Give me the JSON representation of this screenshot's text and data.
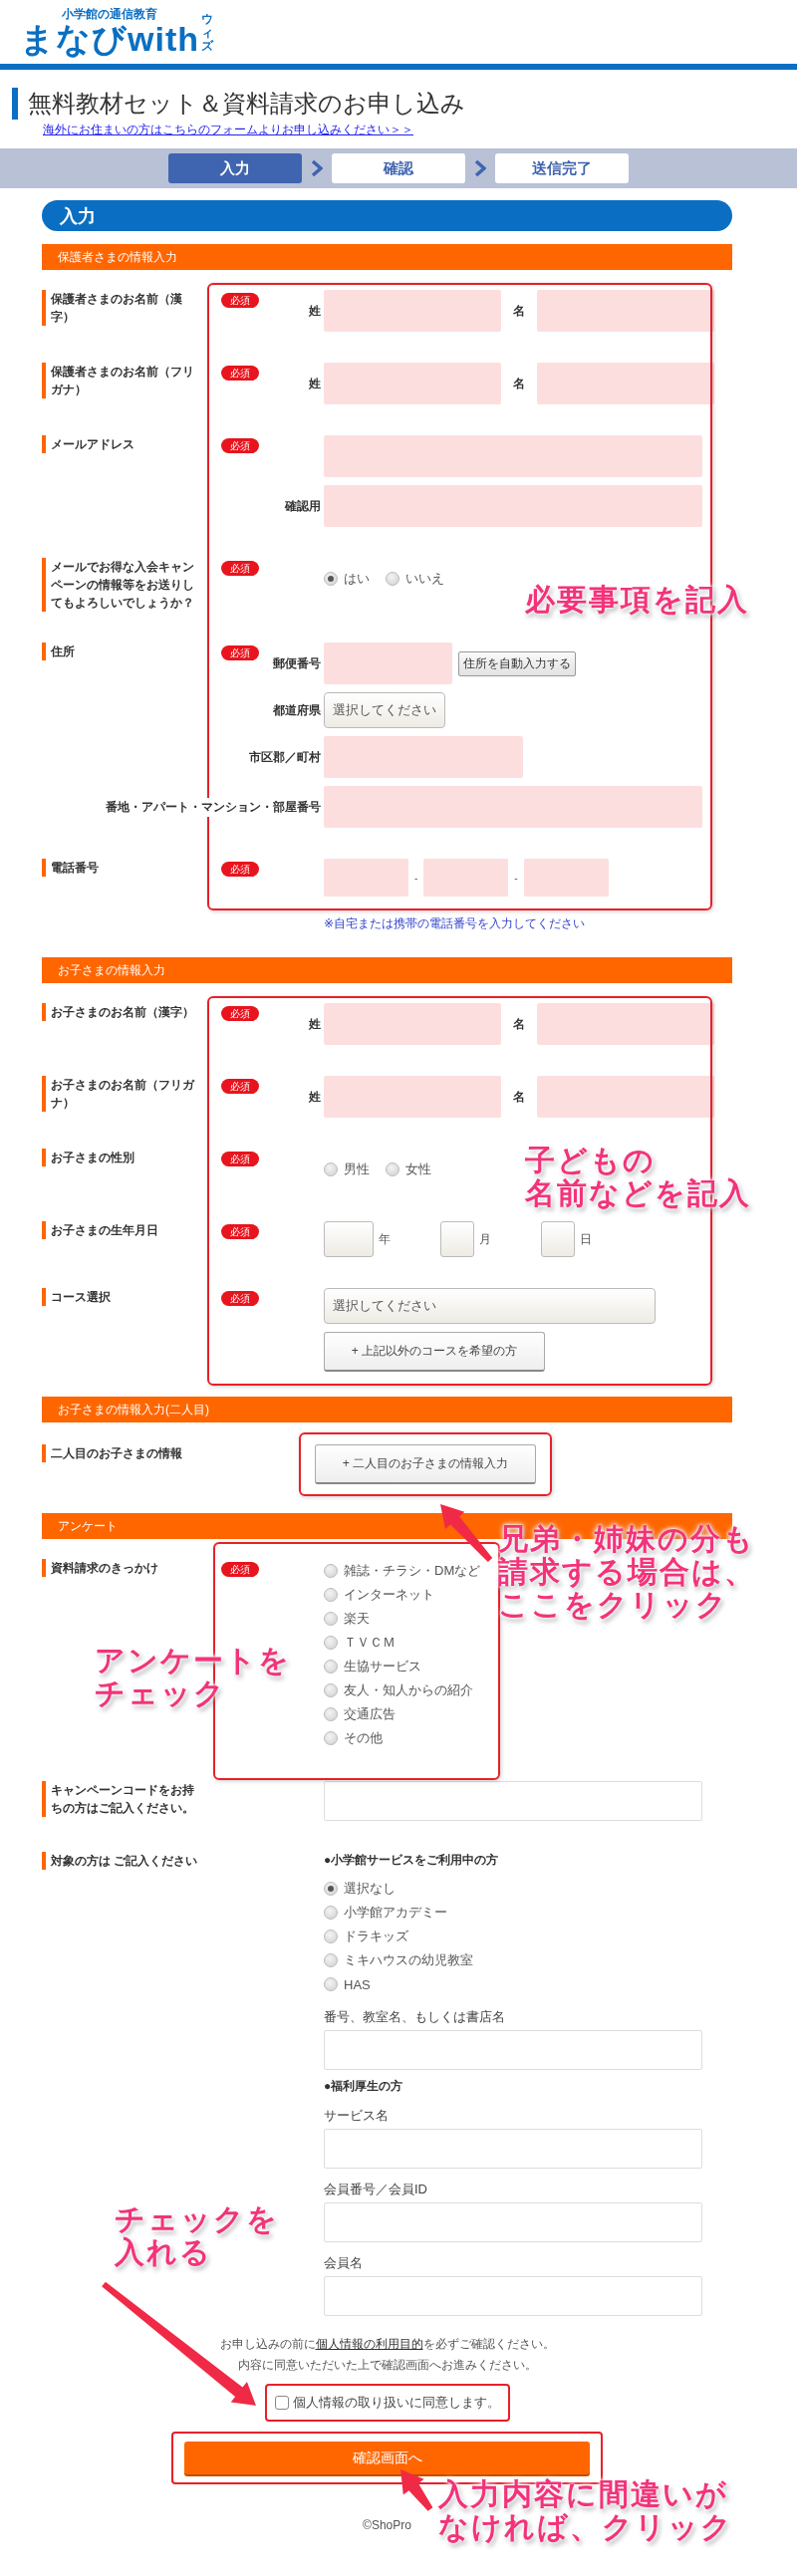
{
  "header": {
    "tagline": "小学館の通信教育",
    "wordmark": "まなびwith",
    "reading": "ウィズ"
  },
  "page_title": "無料教材セット＆資料請求のお申し込み",
  "overseas_link": "海外にお住まいの方はこちらのフォームよりお申し込みください＞＞",
  "steps": [
    {
      "label": "入力",
      "selected": true
    },
    {
      "label": "確認",
      "selected": false
    },
    {
      "label": "送信完了",
      "selected": false
    }
  ],
  "form_heading": "入力",
  "sections": [
    {
      "title": "保護者さまの情報入力",
      "kind": "rows",
      "note": "※自宅または携帯の電話番号を入力してください",
      "rows": [
        {
          "label": "保護者さまのお名前（漢字）",
          "badge": "必須",
          "lines": [
            {
              "kind": "pair",
              "parts": [
                "姓",
                "名"
              ]
            }
          ]
        },
        {
          "label": "保護者さまのお名前（フリガナ）",
          "badge": "必須",
          "lines": [
            {
              "kind": "pair",
              "parts": [
                "姓",
                "名"
              ]
            }
          ]
        },
        {
          "label": "メールアドレス",
          "badge": "必須",
          "lines": [
            {
              "kind": "wide"
            },
            {
              "kind": "wide",
              "label": "確認用"
            }
          ]
        },
        {
          "label": "メールでお得な入会キャンペーンの情報等をお送りしてもよろしいでしょうか？",
          "badge": "必須",
          "lines": [
            {
              "kind": "radio_row",
              "options": [
                {
                  "label": "はい",
                  "selected": true
                },
                {
                  "label": "いいえ",
                  "selected": false
                }
              ]
            }
          ]
        },
        {
          "label": "住所",
          "badge": "必須",
          "lines": [
            {
              "kind": "zip",
              "label": "郵便番号",
              "button": "住所を自動入力する"
            },
            {
              "kind": "select",
              "label": "都道府県",
              "value": "選択してください"
            },
            {
              "kind": "mid",
              "label": "市区郡／町村"
            },
            {
              "kind": "wide",
              "label": "番地・アパート・マンション・部屋番号"
            }
          ]
        },
        {
          "label": "電話番号",
          "badge": "必須",
          "lines": [
            {
              "kind": "phone",
              "separators": [
                "-",
                "-"
              ]
            }
          ]
        }
      ]
    },
    {
      "title": "お子さまの情報入力",
      "kind": "rows",
      "rows": [
        {
          "label": "お子さまのお名前（漢字）",
          "badge": "必須",
          "lines": [
            {
              "kind": "pair",
              "parts": [
                "姓",
                "名"
              ]
            }
          ]
        },
        {
          "label": "お子さまのお名前（フリガナ）",
          "badge": "必須",
          "lines": [
            {
              "kind": "pair",
              "parts": [
                "姓",
                "名"
              ]
            }
          ]
        },
        {
          "label": "お子さまの性別",
          "badge": "必須",
          "lines": [
            {
              "kind": "radio_row",
              "options": [
                {
                  "label": "男性",
                  "selected": false
                },
                {
                  "label": "女性",
                  "selected": false
                }
              ]
            }
          ]
        },
        {
          "label": "お子さまの生年月日",
          "badge": "必須",
          "lines": [
            {
              "kind": "date",
              "units": [
                "年",
                "月",
                "日"
              ]
            }
          ]
        },
        {
          "label": "コース選択",
          "badge": "必須",
          "lines": [
            {
              "kind": "long_select",
              "value": "選択してください"
            },
            {
              "kind": "add_button",
              "text": "+ 上記以外のコースを希望の方"
            }
          ]
        }
      ]
    },
    {
      "title": "お子さまの情報入力(二人目)",
      "kind": "control",
      "rows": [
        {
          "label": "二人目のお子さまの情報",
          "lines": [
            {
              "kind": "add_button",
              "text": "+ 二人目のお子さまの情報入力"
            }
          ]
        }
      ]
    },
    {
      "title": "アンケート",
      "kind": "options",
      "rows": [
        {
          "label": "資料請求のきっかけ",
          "badge": "必須",
          "lines": [
            {
              "kind": "radio_list",
              "options": [
                {
                  "label": "雑誌・チラシ・DMなど",
                  "selected": false
                },
                {
                  "label": "インターネット",
                  "selected": false
                },
                {
                  "label": "楽天",
                  "selected": false
                },
                {
                  "label": "ＴＶＣＭ",
                  "selected": false
                },
                {
                  "label": "生協サービス",
                  "selected": false
                },
                {
                  "label": "友人・知人からの紹介",
                  "selected": false
                },
                {
                  "label": "交通広告",
                  "selected": false
                },
                {
                  "label": "その他",
                  "selected": false
                }
              ]
            }
          ]
        },
        {
          "label": "キャンペーンコードをお持ちの方はご記入ください。",
          "lines": [
            {
              "kind": "wide"
            }
          ]
        },
        {
          "label": "対象の方は ご記入ください",
          "lines": [
            {
              "kind": "heading",
              "text": "●小学館サービスをご利用中の方"
            },
            {
              "kind": "radio_list",
              "options": [
                {
                  "label": "選択なし",
                  "selected": true
                },
                {
                  "label": "小学館アカデミー",
                  "selected": false
                },
                {
                  "label": "ドラキッズ",
                  "selected": false
                },
                {
                  "label": "ミキハウスの幼児教室",
                  "selected": false
                },
                {
                  "label": "HAS",
                  "selected": false
                }
              ]
            },
            {
              "kind": "captioned",
              "caption": "番号、教室名、もしくは書店名"
            },
            {
              "kind": "heading",
              "text": "●福利厚生の方"
            },
            {
              "kind": "captioned",
              "caption": "サービス名"
            },
            {
              "kind": "captioned",
              "caption": "会員番号／会員ID"
            },
            {
              "kind": "captioned",
              "caption": "会員名"
            }
          ]
        }
      ]
    }
  ],
  "consent": {
    "before": "お申し込みの前に",
    "link": "個人情報の利用目的",
    "after": "を必ずご確認ください。",
    "second": "内容に同意いただいた上で確認画面へお進みください。",
    "checkbox": {
      "label": "個人情報の取り扱いに同意します。",
      "checked": false,
      "framed": true
    }
  },
  "submit": {
    "label": "確認画面へ",
    "framed": true
  },
  "footer": "©ShoPro",
  "annotations": [
    {
      "lines": [
        "必要事項を記入"
      ],
      "arrow": false
    },
    {
      "lines": [
        "子どもの",
        "名前などを記入"
      ],
      "arrow": false
    },
    {
      "lines": [
        "兄弟・姉妹の分も",
        "請求する場合は、",
        "ここをクリック"
      ],
      "arrow": true
    },
    {
      "lines": [
        "アンケートを",
        "チェック"
      ],
      "arrow": false
    },
    {
      "lines": [
        "チェックを",
        "入れる"
      ],
      "arrow": true
    },
    {
      "lines": [
        "入力内容に間違いが",
        "なければ、クリック"
      ],
      "arrow": true
    }
  ]
}
